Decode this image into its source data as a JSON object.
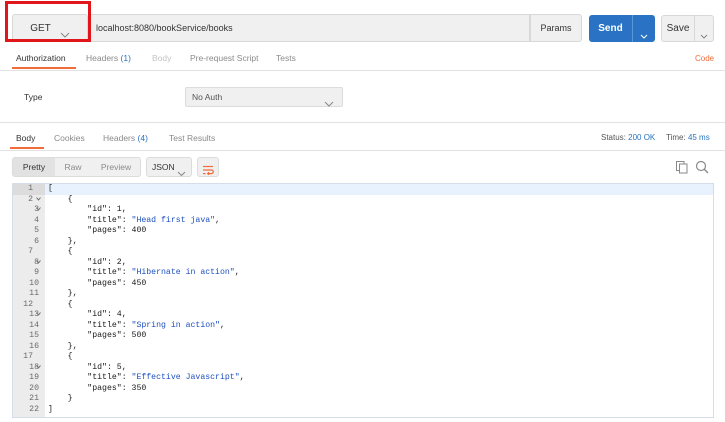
{
  "request": {
    "method": "GET",
    "url": "localhost:8080/bookService/books",
    "params_label": "Params",
    "send_label": "Send",
    "save_label": "Save"
  },
  "request_tabs": [
    {
      "label": "Authorization",
      "count": "",
      "active": true
    },
    {
      "label": "Headers",
      "count": "(1)",
      "active": false
    },
    {
      "label": "Body",
      "count": "",
      "active": false
    },
    {
      "label": "Pre-request Script",
      "count": "",
      "active": false
    },
    {
      "label": "Tests",
      "count": "",
      "active": false
    }
  ],
  "code_link": "Code",
  "auth": {
    "type_label": "Type",
    "type_value": "No Auth"
  },
  "response_tabs": [
    {
      "label": "Body",
      "count": "",
      "active": true
    },
    {
      "label": "Cookies",
      "count": "",
      "active": false
    },
    {
      "label": "Headers",
      "count": "(4)",
      "active": false
    },
    {
      "label": "Test Results",
      "count": "",
      "active": false
    }
  ],
  "status": {
    "status_label": "Status:",
    "status_value": "200 OK",
    "time_label": "Time:",
    "time_value": "45 ms"
  },
  "view_modes": [
    "Pretty",
    "Raw",
    "Preview"
  ],
  "format": "JSON",
  "code_lines": [
    "[",
    "    {",
    "        \"id\": 1,",
    "        \"title\": \"Head first java\",",
    "        \"pages\": 400",
    "    },",
    "    {",
    "        \"id\": 2,",
    "        \"title\": \"Hibernate in action\",",
    "        \"pages\": 450",
    "    },",
    "    {",
    "        \"id\": 4,",
    "        \"title\": \"Spring in action\",",
    "        \"pages\": 500",
    "    },",
    "    {",
    "        \"id\": 5,",
    "        \"title\": \"Effective Javascript\",",
    "        \"pages\": 350",
    "    }",
    "]"
  ],
  "line_numbers": [
    "1",
    "2",
    "3",
    "4",
    "5",
    "6",
    "7",
    "8",
    "9",
    "10",
    "11",
    "12",
    "13",
    "14",
    "15",
    "16",
    "17",
    "18",
    "19",
    "20",
    "21",
    "22"
  ],
  "foldable_lines": [
    1,
    2,
    7,
    12,
    17
  ],
  "colors": {
    "send_blue": "#2a73c4",
    "highlight_red": "#e0161b",
    "tab_underline": "#f26b3a"
  }
}
